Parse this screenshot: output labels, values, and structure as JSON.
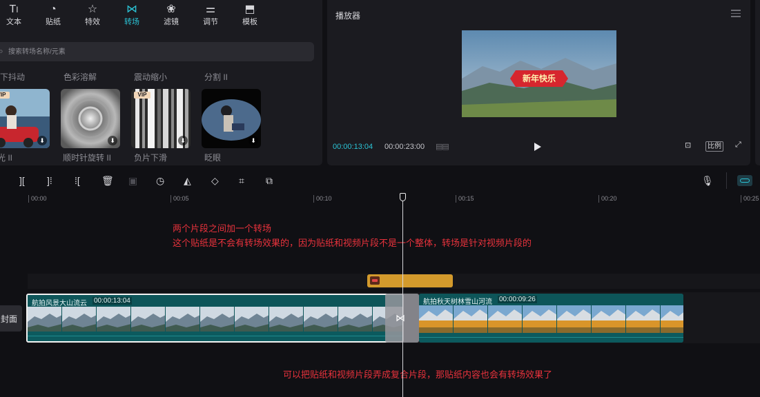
{
  "categories": [
    {
      "label": "文本",
      "icon": "text-icon"
    },
    {
      "label": "贴纸",
      "icon": "sticker-icon"
    },
    {
      "label": "特效",
      "icon": "effects-icon"
    },
    {
      "label": "转场",
      "icon": "transition-icon"
    },
    {
      "label": "滤镜",
      "icon": "filter-icon"
    },
    {
      "label": "调节",
      "icon": "adjust-icon"
    },
    {
      "label": "模板",
      "icon": "template-icon"
    }
  ],
  "active_category": "转场",
  "search": {
    "placeholder": "搜索转场名称/元素"
  },
  "section_labels": [
    "向下抖动",
    "色彩溶解",
    "震动缩小",
    "分割 II"
  ],
  "transitions": [
    {
      "name": "光 II",
      "vip": true,
      "vip_label": "VIP"
    },
    {
      "name": "顺时针旋转 II",
      "vip": false
    },
    {
      "name": "负片下滑",
      "vip": true,
      "vip_label": "VIP"
    },
    {
      "name": "眨眼",
      "vip": false
    }
  ],
  "player": {
    "title": "播放器",
    "current_time": "00:00:13:04",
    "total_time": "00:00:23:00",
    "ratio_label": "比例",
    "video_banner_text": "新年快乐"
  },
  "ruler": [
    "00:00",
    "00:05",
    "00:10",
    "00:15",
    "00:20",
    "00:25"
  ],
  "annotations": {
    "top_line1": "两个片段之间加一个转场",
    "top_line2": "这个贴纸是不会有转场效果的，因为贴纸和视频片段不是一个整体，转场是针对视频片段的",
    "bottom": "可以把贴纸和视频片段弄成复合片段，那贴纸内容也会有转场效果了"
  },
  "cover_label": "封面",
  "clips": [
    {
      "name": "航拍风景大山流云",
      "duration": "00:00:13:04"
    },
    {
      "name": "航拍秋天树林雪山河流",
      "duration": "00:00:09:26"
    }
  ],
  "colors": {
    "accent": "#2bc4d6",
    "annotation": "#e8323c",
    "sticker_clip": "#d39a2c",
    "video_track": "#0f5a5e"
  }
}
